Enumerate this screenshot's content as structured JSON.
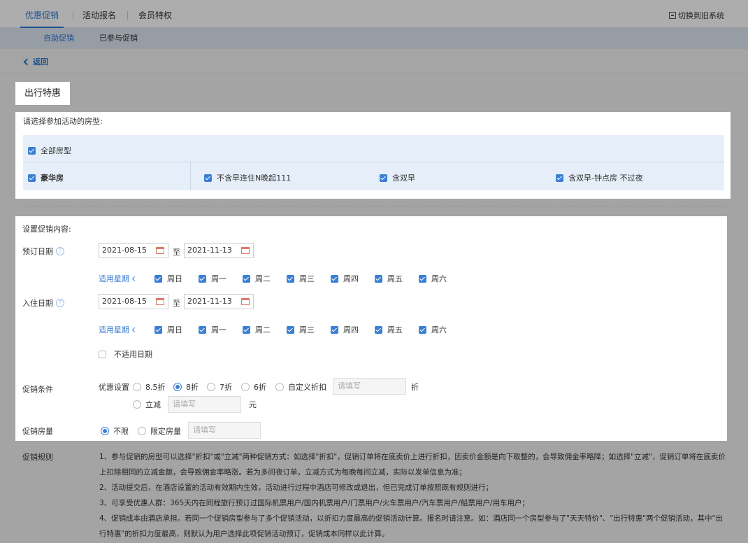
{
  "top_nav": {
    "tabs": [
      {
        "label": "优惠促销",
        "active": true
      },
      {
        "label": "活动报名",
        "active": false
      },
      {
        "label": "会员特权",
        "active": false
      }
    ],
    "switch_label": "切换到旧系统"
  },
  "sub_nav": {
    "tabs": [
      {
        "label": "自助促销",
        "active": true
      },
      {
        "label": "已参与促销",
        "active": false
      }
    ]
  },
  "back_label": "返回",
  "page_title": "出行特惠",
  "room_section": {
    "label": "请选择参加活动的房型:",
    "all_rooms": {
      "label": "全部房型",
      "checked": true
    },
    "room_type": {
      "label": "豪华房",
      "checked": true
    },
    "plans": [
      {
        "label": "不含早连住N晚起111",
        "checked": true
      },
      {
        "label": "含双早",
        "checked": true
      },
      {
        "label": "含双早-钟点房 不过夜",
        "checked": true
      }
    ]
  },
  "promo_section": {
    "label": "设置促销内容:",
    "booking_date": {
      "label": "预订日期",
      "start": "2021-08-15",
      "to": "至",
      "end": "2021-11-13",
      "weekday_label": "适用星期",
      "weekdays": [
        "周日",
        "周一",
        "周二",
        "周三",
        "周四",
        "周五",
        "周六"
      ]
    },
    "checkin_date": {
      "label": "入住日期",
      "start": "2021-08-15",
      "to": "至",
      "end": "2021-11-13",
      "weekday_label": "适用星期",
      "weekdays": [
        "周日",
        "周一",
        "周二",
        "周三",
        "周四",
        "周五",
        "周六"
      ]
    },
    "not_applicable_dates": {
      "label": "不适用日期",
      "checked": false
    },
    "condition": {
      "label": "促销条件",
      "setting_label": "优惠设置",
      "options": [
        {
          "label": "8.5折",
          "selected": false
        },
        {
          "label": "8折",
          "selected": true
        },
        {
          "label": "7折",
          "selected": false
        },
        {
          "label": "6折",
          "selected": false
        },
        {
          "label": "自定义折扣",
          "selected": false
        }
      ],
      "custom_placeholder": "请填写",
      "discount_unit": "折",
      "reduce_label": "立减",
      "reduce_placeholder": "请填写",
      "reduce_unit": "元"
    },
    "room_quantity": {
      "label": "促销房量",
      "options": [
        {
          "label": "不限",
          "selected": true
        },
        {
          "label": "限定房量",
          "selected": false
        }
      ],
      "placeholder": "请填写"
    }
  },
  "rules": {
    "label": "促销规则",
    "items": [
      "1、参与促销的房型可以选择\"折扣\"或\"立减\"两种促销方式：如选择\"折扣\"，促销订单将在底卖价上进行折扣，因卖价金额是向下取整的，会导致佣金率略降；如选择\"立减\"，促销订单将在底卖价上扣除相同的立减金额，会导致佣金率略涨。若为多间夜订单，立减方式为每晚每间立减，实际以发单信息为准；",
      "2、活动提交后，在酒店设置的活动有效期内生效，活动进行过程中酒店可修改或退出，但已完成订单按照既有规则进行；",
      "3、可享受优惠人群：365天内在同程旅行预订过国际机票用户/国内机票用户/门票用户/火车票用户/汽车票用户/船票用户/用车用户；",
      "4、促销成本由酒店承担。若同一个促销房型参与了多个促销活动，以折扣力度最高的促销活动计算。报名时请注意。如：酒店同一个房型参与了\"天天特价\"、\"出行特惠\"两个促销活动，其中\"出行特惠\"的折扣力度最高，则默认为用户选择此项促销活动预订，促销成本同样以此计算。"
    ]
  }
}
